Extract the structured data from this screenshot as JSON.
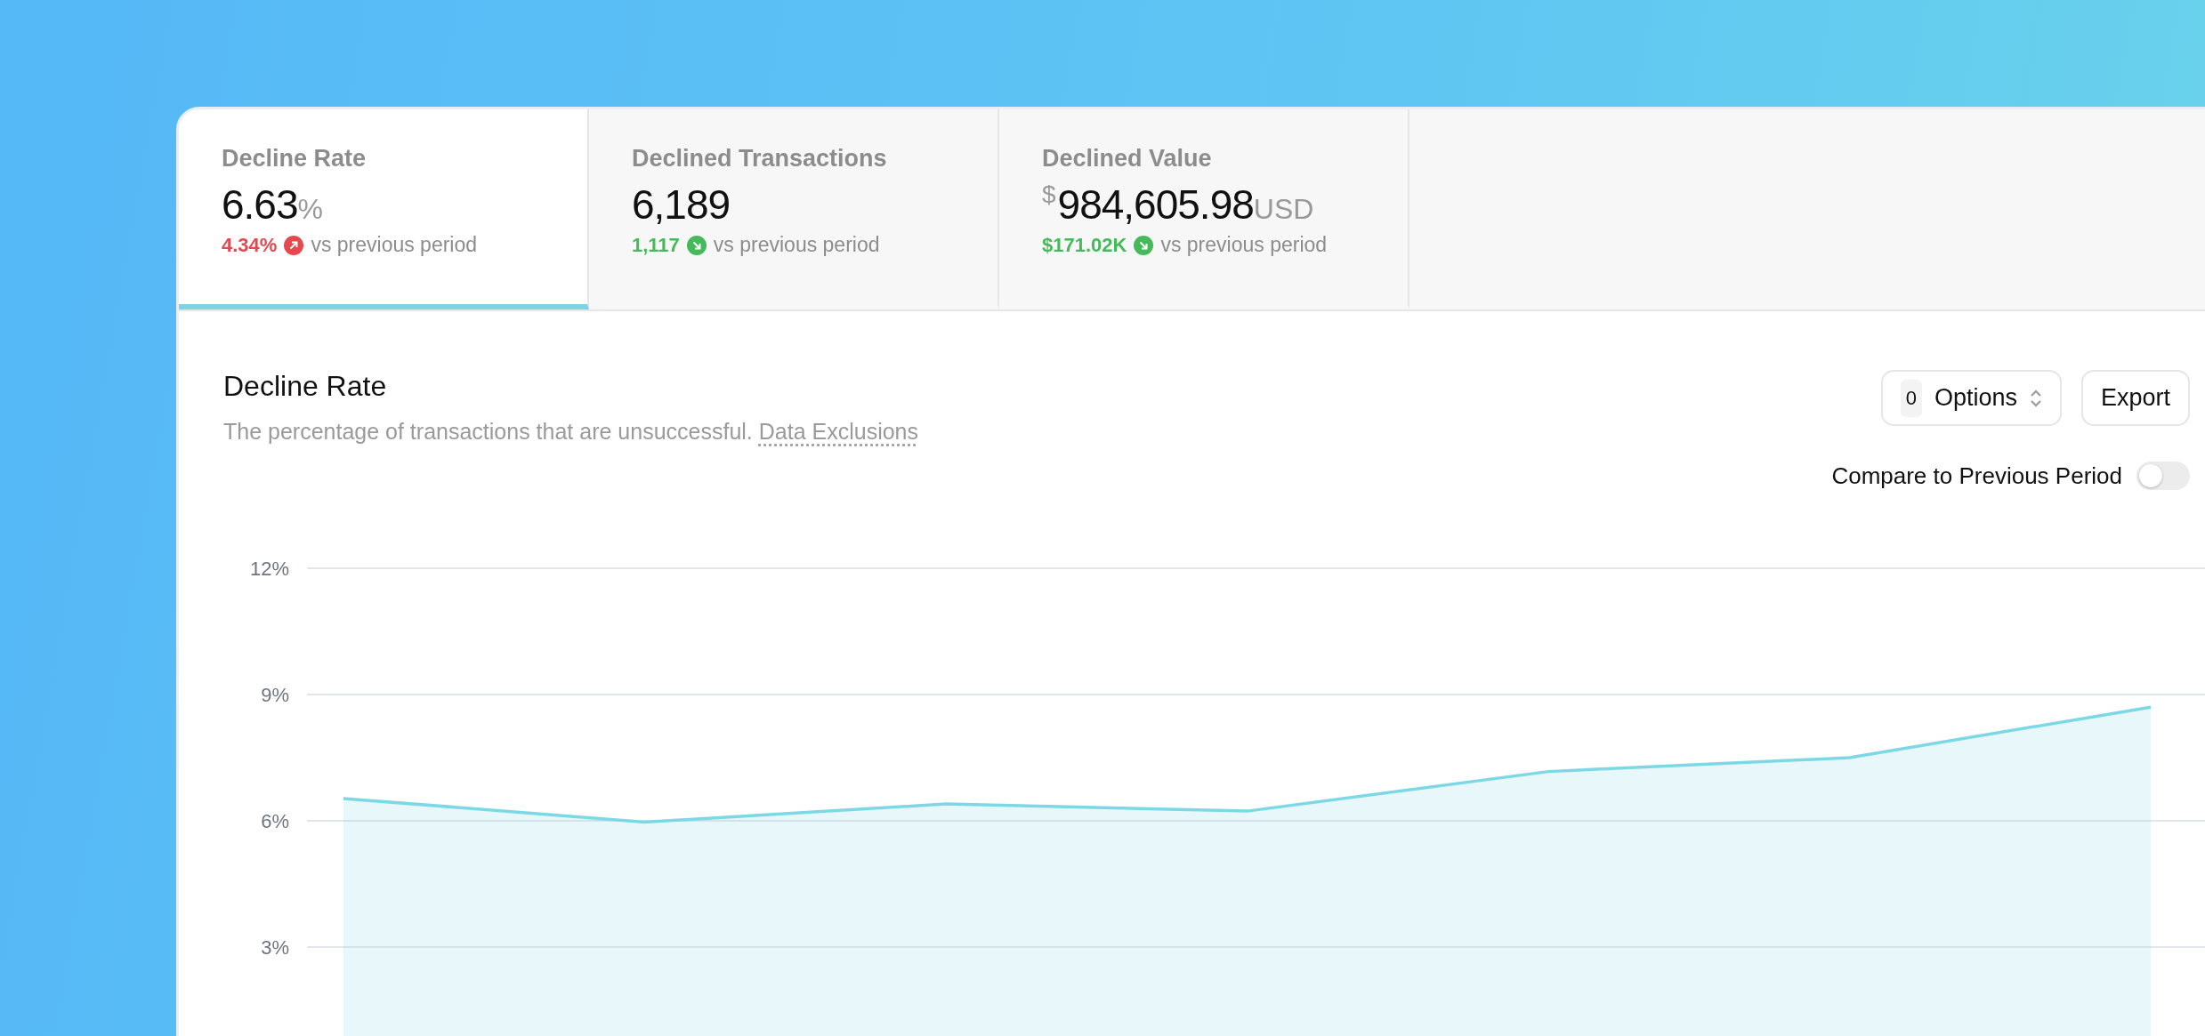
{
  "metrics": [
    {
      "title": "Decline Rate",
      "value": "6.63",
      "suffix": "%",
      "change": "4.34%",
      "kind": "up",
      "color": "#e5484d",
      "note": "vs previous period",
      "selected": true
    },
    {
      "title": "Declined Transactions",
      "value": "6,189",
      "change": "1,117",
      "kind": "down",
      "color": "#46b95a",
      "note": "vs previous period",
      "selected": false
    },
    {
      "title": "Declined Value",
      "prefix": "$",
      "value": "984,605.98",
      "suffix": "USD",
      "change": "$171.02K",
      "kind": "down",
      "color": "#46b95a",
      "note": "vs previous period",
      "selected": false
    }
  ],
  "section": {
    "title": "Decline Rate",
    "description": "The percentage of transactions that are unsuccessful.",
    "link": "Data Exclusions"
  },
  "options": {
    "count": "0",
    "label": "Options"
  },
  "export": {
    "label": "Export"
  },
  "compare": {
    "label": "Compare to Previous Period",
    "on": false
  },
  "chart_data": {
    "type": "area",
    "grid": true,
    "ylim": [
      0,
      12
    ],
    "yticks": [
      {
        "value": 3,
        "label": "3%"
      },
      {
        "value": 6,
        "label": "6%"
      },
      {
        "value": 9,
        "label": "9%"
      },
      {
        "value": 12,
        "label": "12%"
      }
    ],
    "series": [
      {
        "color": "#7dd8e6",
        "values": [
          6.53,
          5.97,
          6.4,
          6.23,
          7.17,
          7.5,
          8.7
        ]
      }
    ]
  }
}
